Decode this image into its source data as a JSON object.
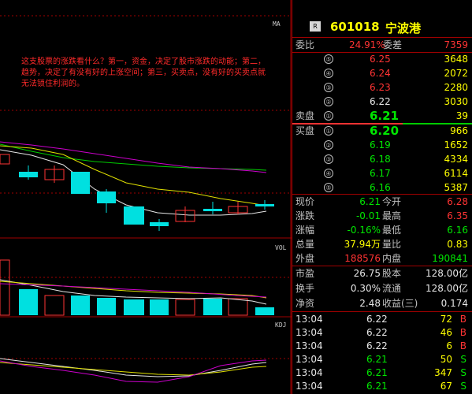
{
  "chart": {
    "top_label": "MA",
    "vol_label": "VOL",
    "kdj_label": "KDJ",
    "comment": "这支股票的涨跌看什么？第一，资金，决定了股市涨跌的动能；第二，趋势，决定了有没有好的上涨空间；第三，买卖点，没有好的买卖点就无法锁住利润的。"
  },
  "header": {
    "badge": "R",
    "code": "601018",
    "name": "宁波港"
  },
  "order_stats": {
    "weibi_label": "委比",
    "weibi_value": "24.91%",
    "weicha_label": "委差",
    "weicha_value": "7359"
  },
  "sell_orders": [
    {
      "level": "⑤",
      "price": "6.25",
      "vol": "3648"
    },
    {
      "level": "④",
      "price": "6.24",
      "vol": "2072"
    },
    {
      "level": "③",
      "price": "6.23",
      "vol": "2280"
    },
    {
      "level": "②",
      "price": "6.22",
      "vol": "3030"
    },
    {
      "label": "卖盘",
      "level": "①",
      "price": "6.21",
      "vol": "39"
    }
  ],
  "buy_orders": [
    {
      "label": "买盘",
      "level": "①",
      "price": "6.20",
      "vol": "966"
    },
    {
      "level": "②",
      "price": "6.19",
      "vol": "1652"
    },
    {
      "level": "③",
      "price": "6.18",
      "vol": "4334"
    },
    {
      "level": "④",
      "price": "6.17",
      "vol": "6114"
    },
    {
      "level": "⑤",
      "price": "6.16",
      "vol": "5387"
    }
  ],
  "quote": [
    {
      "l1": "现价",
      "v1": "6.21",
      "l2": "今开",
      "v2": "6.28"
    },
    {
      "l1": "涨跌",
      "v1": "-0.01",
      "l2": "最高",
      "v2": "6.35"
    },
    {
      "l1": "涨幅",
      "v1": "-0.16%",
      "l2": "最低",
      "v2": "6.16"
    },
    {
      "l1": "总量",
      "v1": "37.94万",
      "l2": "量比",
      "v2": "0.83"
    },
    {
      "l1": "外盘",
      "v1": "188576",
      "l2": "内盘",
      "v2": "190841"
    }
  ],
  "fundamentals": [
    {
      "l1": "市盈",
      "v1": "26.75",
      "l2": "股本",
      "v2": "128.00亿"
    },
    {
      "l1": "换手",
      "v1": "0.30%",
      "l2": "流通",
      "v2": "128.00亿"
    },
    {
      "l1": "净资",
      "v1": "2.48",
      "l2": "收益(三)",
      "v2": "0.174"
    }
  ],
  "ticks": [
    {
      "time": "13:04",
      "price": "6.22",
      "vol": "72",
      "side": "B"
    },
    {
      "time": "13:04",
      "price": "6.22",
      "vol": "46",
      "side": "B"
    },
    {
      "time": "13:04",
      "price": "6.22",
      "vol": "6",
      "side": "B"
    },
    {
      "time": "13:04",
      "price": "6.21",
      "vol": "50",
      "side": "S"
    },
    {
      "time": "13:04",
      "price": "6.21",
      "vol": "347",
      "side": "S"
    },
    {
      "time": "13:04",
      "price": "6.21",
      "vol": "67",
      "side": "S"
    }
  ],
  "colors": {
    "up": "#ff3333",
    "down": "#00e0e0",
    "ma5": "#e6e6e6",
    "ma10": "#e0e000",
    "ma20": "#cc00cc",
    "ma30": "#00cc00",
    "grid": "#a00000"
  }
}
